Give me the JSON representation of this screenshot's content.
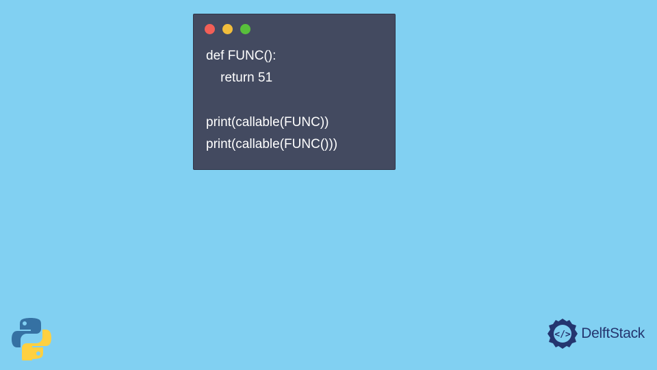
{
  "code_block": {
    "lines": [
      "def FUNC():",
      "    return 51",
      "",
      "print(callable(FUNC))",
      "print(callable(FUNC()))"
    ]
  },
  "brand": {
    "name": "DelftStack"
  },
  "colors": {
    "background": "#81d0f2",
    "code_bg": "#434a60",
    "code_text": "#ffffff",
    "dot_red": "#f25f57",
    "dot_yellow": "#f2be3c",
    "dot_green": "#58c03b",
    "brand_text": "#24356f"
  }
}
